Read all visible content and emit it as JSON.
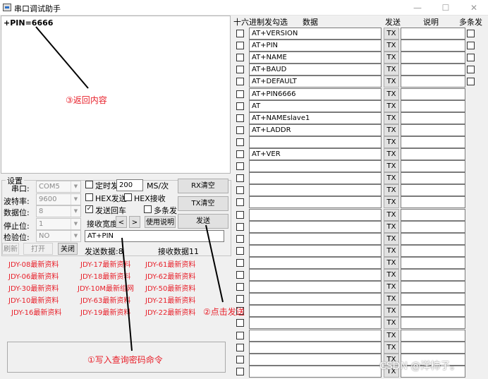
{
  "window": {
    "title": "串口调试助手",
    "min": "—",
    "max": "☐",
    "close": "✕"
  },
  "receive": {
    "text": "+PIN=6666"
  },
  "settings": {
    "group_title": "设置",
    "port_label": "串口:",
    "port_value": "COM5",
    "baud_label": "波特率:",
    "baud_value": "9600",
    "databits_label": "数据位:",
    "databits_value": "8",
    "stopbits_label": "停止位:",
    "stopbits_value": "1",
    "parity_label": "检验位:",
    "parity_value": "NO",
    "timed_send_label": "定时发",
    "interval_value": "200",
    "interval_unit": "MS/次",
    "hex_send_label": "HEX发送",
    "hex_recv_label": "HEX接收",
    "echo_label": "发送回车",
    "echo_check": "✓",
    "multi_send_label": "多条发",
    "recv_width_label": "接收宽度",
    "prev": "<",
    "next": ">",
    "rx_clear": "RX清空",
    "tx_clear": "TX清空",
    "send": "发送",
    "help": "使用说明",
    "refresh": "刷新",
    "open": "打开",
    "close": "关闭",
    "send_input_value": "AT+PIN",
    "sent_count_label": "发送数据:8",
    "recv_count_label": "接收数据11"
  },
  "links": [
    [
      "JDY-08最新资料",
      "JDY-17最新资料",
      "JDY-61最新资料"
    ],
    [
      "JDY-06最新资料",
      "JDY-18最新资料",
      "JDY-62最新资料"
    ],
    [
      "JDY-30最新资料",
      "JDY-10M最新组网",
      "JDY-50最新资料"
    ],
    [
      "JDY-10最新资料",
      "JDY-63最新资料",
      "JDY-21最新资料"
    ],
    [
      "JDY-16最新资料",
      "JDY-19最新资料",
      "JDY-22最新资料"
    ]
  ],
  "multi": {
    "headers": {
      "hex_check": "十六进制发勾选",
      "data": "数据",
      "send": "发送",
      "desc": "说明",
      "multi": "多条发"
    },
    "tx_label": "TX",
    "rows": [
      "AT+VERSION",
      "AT+PIN",
      "AT+NAME",
      "AT+BAUD",
      "AT+DEFAULT",
      "AT+PIN6666",
      "AT",
      "AT+NAMEslave1",
      "AT+LADDR",
      "",
      "AT+VER",
      "",
      "",
      "",
      "",
      "",
      "",
      "",
      "",
      "",
      "",
      "",
      "",
      "",
      "",
      "",
      "",
      "",
      ""
    ]
  },
  "annotations": {
    "return": "③返回内容",
    "click_send": "②点击发送",
    "write_cmd": "①写入查询密码命令"
  },
  "watermark": "CSDN @洋柿子。",
  "colors": {
    "annotation": "#e8202a",
    "link": "#e8202a"
  }
}
